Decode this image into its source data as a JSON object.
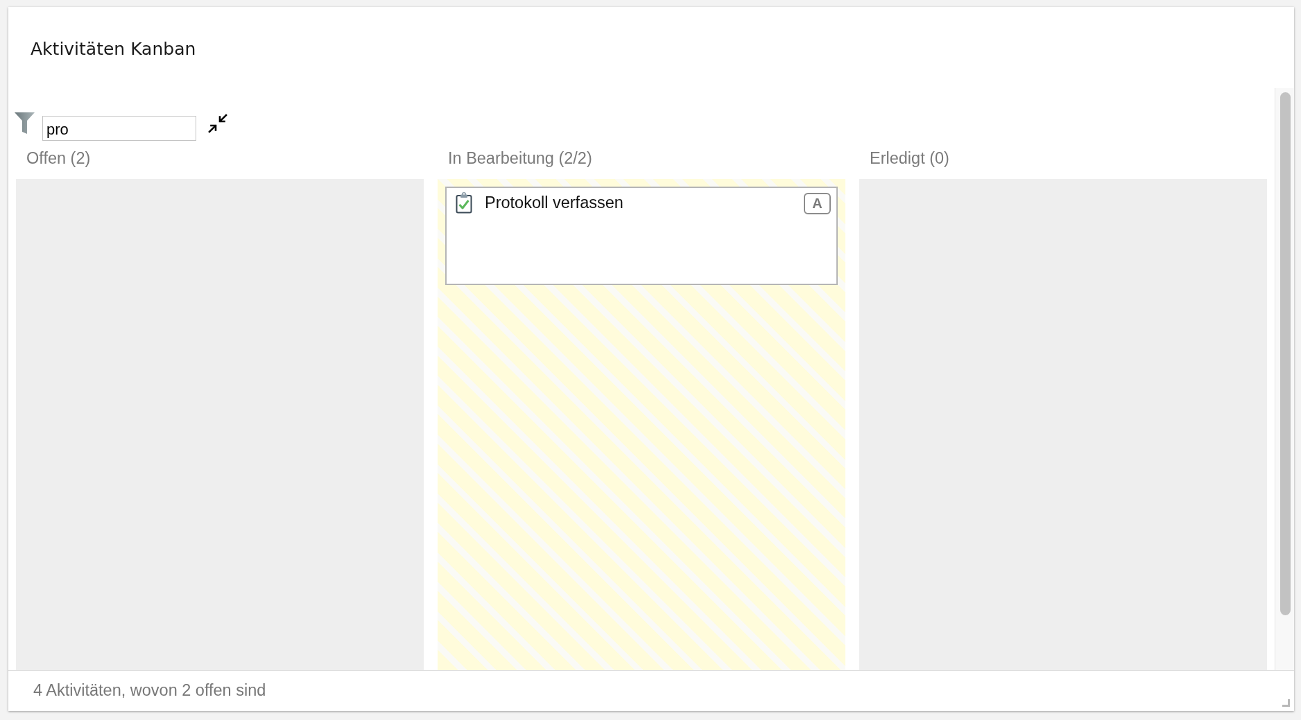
{
  "window": {
    "title": "Aktivitäten Kanban"
  },
  "filter": {
    "value": "pro"
  },
  "columns": [
    {
      "title": "Offen (2)",
      "highlighted": false
    },
    {
      "title": "In Bearbeitung (2/2)",
      "highlighted": true,
      "cards": [
        {
          "title": "Protokoll verfassen",
          "badge": "A"
        }
      ]
    },
    {
      "title": "Erledigt (0)",
      "highlighted": false
    }
  ],
  "status_bar": {
    "text": "4 Aktivitäten, wovon 2 offen sind"
  }
}
